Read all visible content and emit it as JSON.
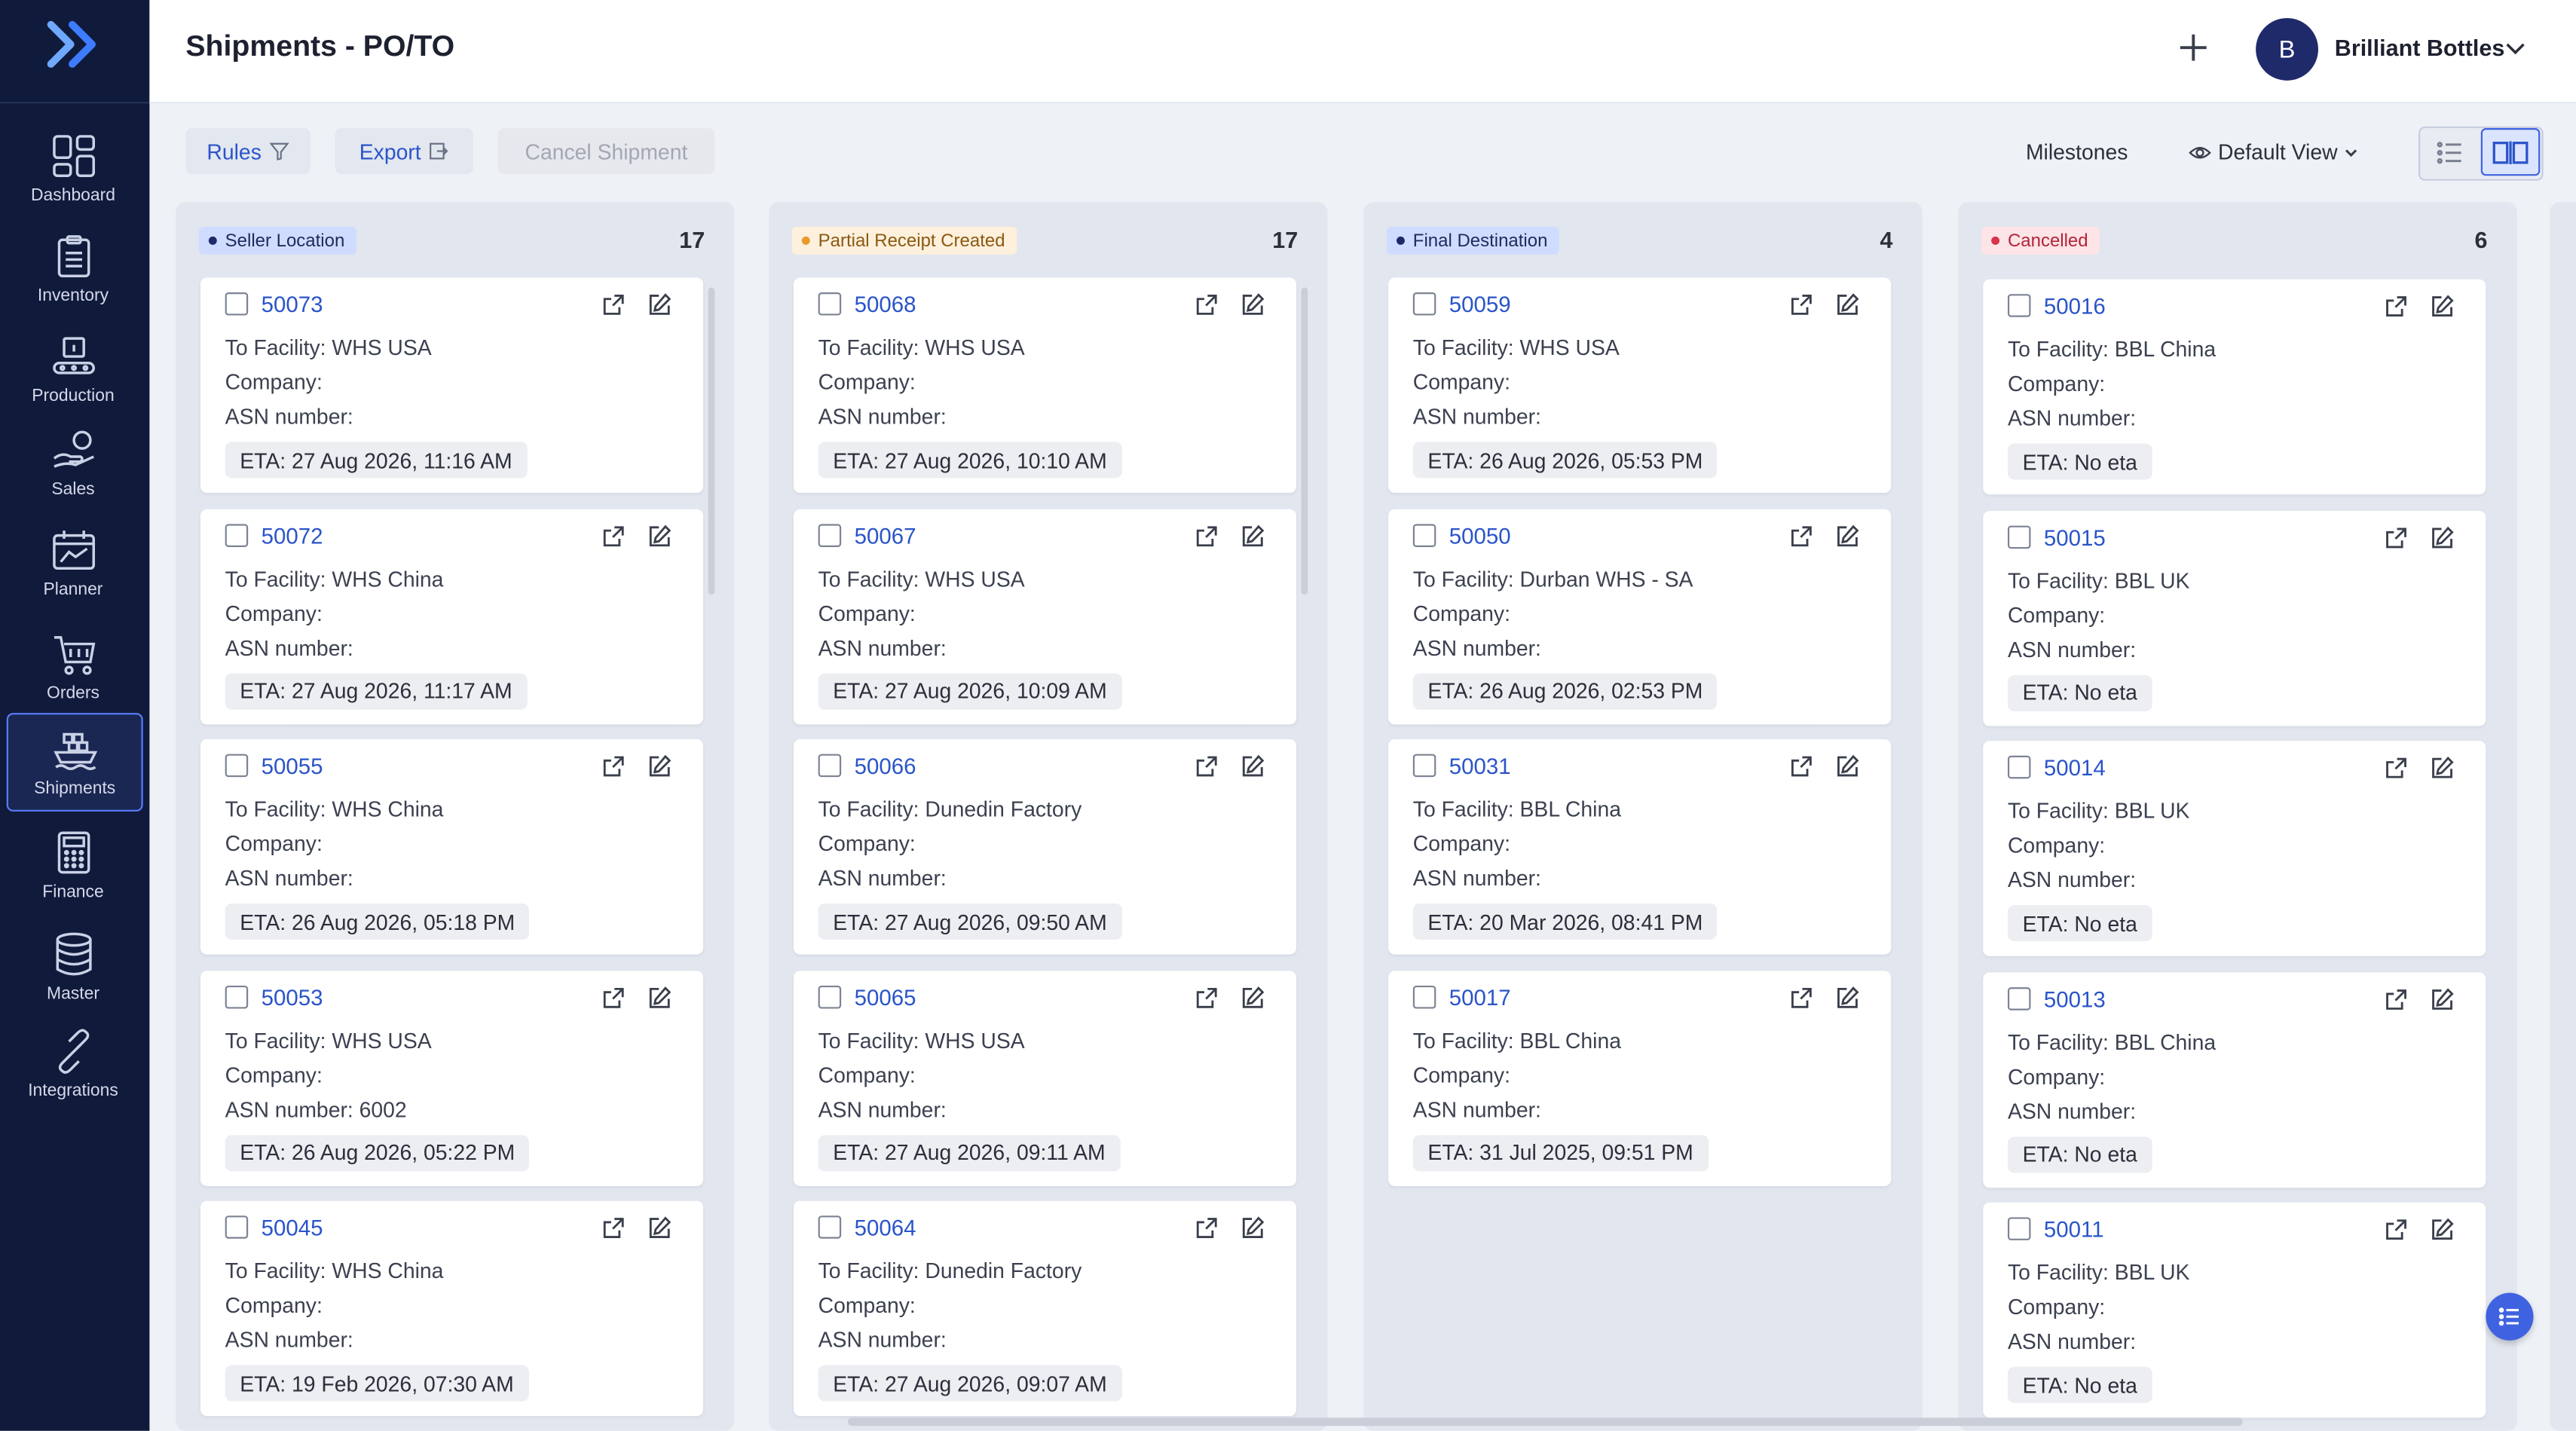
{
  "app": {
    "title": "Shipments - PO/TO",
    "company": "Brilliant Bottles",
    "avatar_initial": "B"
  },
  "sidebar": {
    "items": [
      {
        "label": "Dashboard",
        "icon": "dashboard-icon"
      },
      {
        "label": "Inventory",
        "icon": "clipboard-icon"
      },
      {
        "label": "Production",
        "icon": "conveyor-icon"
      },
      {
        "label": "Sales",
        "icon": "hand-coin-icon"
      },
      {
        "label": "Planner",
        "icon": "calendar-chart-icon"
      },
      {
        "label": "Orders",
        "icon": "cart-icon"
      },
      {
        "label": "Shipments",
        "icon": "ship-icon",
        "active": true
      },
      {
        "label": "Finance",
        "icon": "calculator-icon"
      },
      {
        "label": "Master",
        "icon": "database-icon"
      },
      {
        "label": "Integrations",
        "icon": "link-icon"
      }
    ]
  },
  "toolbar": {
    "rules": "Rules",
    "export": "Export",
    "cancel_shipment": "Cancel Shipment",
    "milestones": "Milestones",
    "default_view": "Default View"
  },
  "colors": {
    "sidebar_bg": "#101a3a",
    "accent": "#2a54c9",
    "seller_location": "#cfdcff",
    "partial_receipt": "#fdf0dc",
    "final_destination": "#cfdcff",
    "cancelled": "#fde4e6"
  },
  "columns": [
    {
      "name": "Seller Location",
      "count": "17",
      "cards": [
        {
          "id": "50073",
          "facility": "To Facility: WHS USA",
          "company": "Company:",
          "asn": "ASN number:",
          "eta": "ETA: 27 Aug 2026, 11:16 AM"
        },
        {
          "id": "50072",
          "facility": "To Facility: WHS China",
          "company": "Company:",
          "asn": "ASN number:",
          "eta": "ETA: 27 Aug 2026, 11:17 AM"
        },
        {
          "id": "50055",
          "facility": "To Facility: WHS China",
          "company": "Company:",
          "asn": "ASN number:",
          "eta": "ETA: 26 Aug 2026, 05:18 PM"
        },
        {
          "id": "50053",
          "facility": "To Facility: WHS USA",
          "company": "Company:",
          "asn": "ASN number: 6002",
          "eta": "ETA: 26 Aug 2026, 05:22 PM"
        },
        {
          "id": "50045",
          "facility": "To Facility: WHS China",
          "company": "Company:",
          "asn": "ASN number:",
          "eta": "ETA: 19 Feb 2026, 07:30 AM"
        }
      ]
    },
    {
      "name": "Partial Receipt Created",
      "count": "17",
      "cards": [
        {
          "id": "50068",
          "facility": "To Facility: WHS USA",
          "company": "Company:",
          "asn": "ASN number:",
          "eta": "ETA: 27 Aug 2026, 10:10 AM"
        },
        {
          "id": "50067",
          "facility": "To Facility: WHS USA",
          "company": "Company:",
          "asn": "ASN number:",
          "eta": "ETA: 27 Aug 2026, 10:09 AM"
        },
        {
          "id": "50066",
          "facility": "To Facility: Dunedin Factory",
          "company": "Company:",
          "asn": "ASN number:",
          "eta": "ETA: 27 Aug 2026, 09:50 AM"
        },
        {
          "id": "50065",
          "facility": "To Facility: WHS USA",
          "company": "Company:",
          "asn": "ASN number:",
          "eta": "ETA: 27 Aug 2026, 09:11 AM"
        },
        {
          "id": "50064",
          "facility": "To Facility: Dunedin Factory",
          "company": "Company:",
          "asn": "ASN number:",
          "eta": "ETA: 27 Aug 2026, 09:07 AM"
        }
      ]
    },
    {
      "name": "Final Destination",
      "count": "4",
      "cards": [
        {
          "id": "50059",
          "facility": "To Facility: WHS USA",
          "company": "Company:",
          "asn": "ASN number:",
          "eta": "ETA: 26 Aug 2026, 05:53 PM"
        },
        {
          "id": "50050",
          "facility": "To Facility: Durban WHS - SA",
          "company": "Company:",
          "asn": "ASN number:",
          "eta": "ETA: 26 Aug 2026, 02:53 PM"
        },
        {
          "id": "50031",
          "facility": "To Facility: BBL China",
          "company": "Company:",
          "asn": "ASN number:",
          "eta": "ETA: 20 Mar 2026, 08:41 PM"
        },
        {
          "id": "50017",
          "facility": "To Facility: BBL China",
          "company": "Company:",
          "asn": "ASN number:",
          "eta": "ETA: 31 Jul 2025, 09:51 PM"
        }
      ]
    },
    {
      "name": "Cancelled",
      "count": "6",
      "cards": [
        {
          "id": "50016",
          "facility": "To Facility: BBL China",
          "company": "Company:",
          "asn": "ASN number:",
          "eta": "ETA: No eta"
        },
        {
          "id": "50015",
          "facility": "To Facility: BBL UK",
          "company": "Company:",
          "asn": "ASN number:",
          "eta": "ETA: No eta"
        },
        {
          "id": "50014",
          "facility": "To Facility: BBL UK",
          "company": "Company:",
          "asn": "ASN number:",
          "eta": "ETA: No eta"
        },
        {
          "id": "50013",
          "facility": "To Facility: BBL China",
          "company": "Company:",
          "asn": "ASN number:",
          "eta": "ETA: No eta"
        },
        {
          "id": "50011",
          "facility": "To Facility: BBL UK",
          "company": "Company:",
          "asn": "ASN number:",
          "eta": "ETA: No eta"
        }
      ]
    }
  ]
}
